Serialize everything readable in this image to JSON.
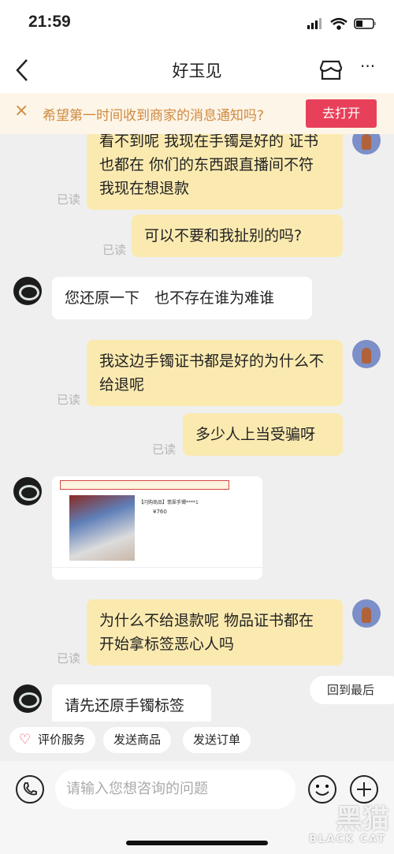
{
  "status_bar": {
    "time": "21:59"
  },
  "nav": {
    "title": "好玉见",
    "icons": [
      "back-icon",
      "shop-icon",
      "more-icon"
    ]
  },
  "banner": {
    "text": "希望第一时间收到商家的消息通知吗?",
    "button": "去打开"
  },
  "messages": [
    {
      "side": "right",
      "text": "看不到呢 我现在手镯是好的 证书也都在 你们的东西跟直播间不符 我现在想退款",
      "read": "已读"
    },
    {
      "side": "right",
      "text": "可以不要和我扯别的吗?",
      "read": "已读"
    },
    {
      "side": "left",
      "text": "您还原一下　也不存在谁为难谁"
    },
    {
      "side": "right",
      "text": "我这边手镯证书都是好的为什么不给退呢",
      "read": "已读"
    },
    {
      "side": "right",
      "text": "多少人上当受骗呀",
      "read": "已读"
    },
    {
      "side": "left",
      "type": "image",
      "product_title": "【闪购商品】翡翠手镯****1",
      "price": "¥760"
    },
    {
      "side": "right",
      "text": "为什么不给退款呢 物品证书都在 开始拿标签恶心人吗",
      "read": "已读"
    },
    {
      "side": "left",
      "text": "请先还原手镯标签"
    }
  ],
  "back_to_last": "回到最后",
  "quick_actions": [
    "评价服务",
    "发送商品",
    "发送订单"
  ],
  "input": {
    "placeholder": "请输入您想咨询的问题"
  },
  "watermark": {
    "cn": "黑猫",
    "en": "BLACK CAT"
  },
  "colors": {
    "accent": "#e8405a",
    "my_bubble": "#fbeab0",
    "banner_text": "#d08a3f"
  }
}
